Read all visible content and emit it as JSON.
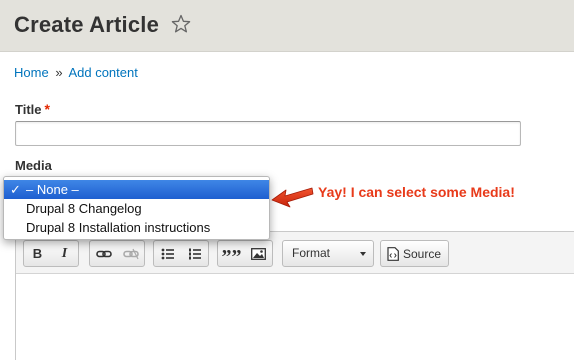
{
  "header": {
    "title": "Create Article"
  },
  "breadcrumb": {
    "home": "Home",
    "separator": "»",
    "current": "Add content"
  },
  "form": {
    "title_label": "Title",
    "title_required_mark": "*",
    "title_value": "",
    "media_label": "Media"
  },
  "media_dropdown": {
    "options": [
      {
        "label": "– None –",
        "selected": true
      },
      {
        "label": "Drupal 8 Changelog",
        "selected": false
      },
      {
        "label": "Drupal 8 Installation instructions",
        "selected": false
      }
    ],
    "check_glyph": "✓"
  },
  "editor": {
    "toolbar": {
      "bold": "B",
      "italic": "I",
      "blockquote": "””",
      "format": "Format",
      "source": "Source"
    }
  },
  "annotation": {
    "text": "Yay! I can select some Media!",
    "color": "#e83a1a"
  },
  "colors": {
    "header_bg": "#e3e2dc",
    "link": "#0074bd",
    "required": "#e32700",
    "selected_option": "#2a6fdc"
  }
}
